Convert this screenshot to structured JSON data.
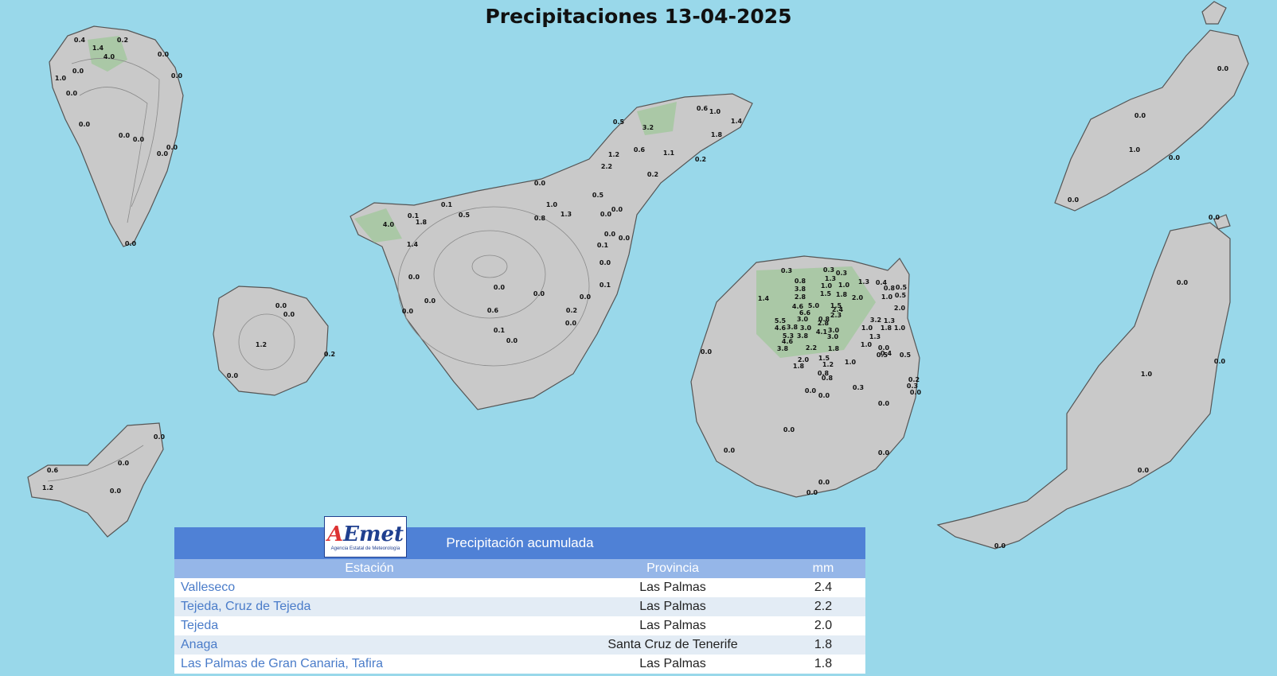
{
  "title": "Precipitaciones 13-04-2025",
  "colors": {
    "sea": "#99d8ea",
    "land": "#c9c9c9",
    "header": "#4f81d6",
    "subheader": "#95b6e8",
    "station_text": "#4a7cc9"
  },
  "map_labels": {
    "la_palma": [
      "0.4",
      "0.2",
      "1.4",
      "4.0",
      "0.0",
      "1.0",
      "0.0",
      "0.0",
      "0.0",
      "0.0",
      "0.0",
      "0.0",
      "0.0",
      "0.0",
      "0.0"
    ],
    "tenerife": [
      "0.6",
      "1.0",
      "1.4",
      "0.5",
      "3.2",
      "1.8",
      "0.6",
      "1.1",
      "1.2",
      "0.2",
      "2.2",
      "0.2",
      "0.0",
      "0.5",
      "1.0",
      "0.1",
      "0.5",
      "0.1",
      "1.3",
      "0.0",
      "0.0",
      "1.8",
      "0.8",
      "4.0",
      "1.4",
      "0.0",
      "0.1",
      "0.0",
      "0.0",
      "0.0",
      "0.0",
      "0.0",
      "0.1",
      "0.0",
      "0.0",
      "0.0",
      "0.6",
      "0.2",
      "0.0",
      "0.1",
      "0.0"
    ],
    "la_gomera": [
      "0.0",
      "0.0",
      "1.2",
      "0.2",
      "0.0"
    ],
    "el_hierro": [
      "0.0",
      "0.6",
      "0.0",
      "1.2",
      "0.0"
    ],
    "gran_canaria": [
      "0.3",
      "0.3",
      "0.3",
      "0.8",
      "1.3",
      "3.8",
      "1.0",
      "1.0",
      "2.8",
      "1.5",
      "1.8",
      "0.4",
      "0.8",
      "0.5",
      "1.3",
      "4.6",
      "5.0",
      "2.0",
      "1.0",
      "0.5",
      "6.6",
      "1.5",
      "0.8",
      "5.5",
      "2.4",
      "2.3",
      "2.0",
      "3.0",
      "2.8",
      "1.3",
      "3.2",
      "4.6",
      "3.8",
      "3.0",
      "4.1",
      "3.0",
      "1.0",
      "1.8",
      "1.0",
      "5.3",
      "3.8",
      "3.0",
      "1.3",
      "4.6",
      "2.2",
      "1.8",
      "1.0",
      "3.8",
      "1.5",
      "0.4",
      "0.5",
      "2.0",
      "1.2",
      "1.0",
      "0.0",
      "0.5",
      "1.8",
      "0.8",
      "0.0",
      "0.8",
      "0.3",
      "0.0",
      "0.0",
      "0.0",
      "0.0",
      "0.0",
      "0.0",
      "0.0",
      "0.0",
      "0.2",
      "0.3",
      "0.0",
      "1.4"
    ],
    "lanzarote": [
      "0.0",
      "0.0",
      "1.0",
      "0.0",
      "0.0"
    ],
    "fuerteventura": [
      "0.0",
      "0.0",
      "1.0",
      "0.0",
      "0.0",
      "0.0"
    ]
  },
  "table": {
    "logo_text": "AEmet",
    "logo_subtitle": "Agencia Estatal de Meteorología",
    "title": "Precipitación acumulada",
    "headers": [
      "Estación",
      "Provincia",
      "mm"
    ],
    "rows": [
      [
        "Valleseco",
        "Las Palmas",
        "2.4"
      ],
      [
        "Tejeda, Cruz de Tejeda",
        "Las Palmas",
        "2.2"
      ],
      [
        "Tejeda",
        "Las Palmas",
        "2.0"
      ],
      [
        "Anaga",
        "Santa Cruz de Tenerife",
        "1.8"
      ],
      [
        "Las Palmas de Gran Canaria, Tafira",
        "Las Palmas",
        "1.8"
      ]
    ]
  }
}
